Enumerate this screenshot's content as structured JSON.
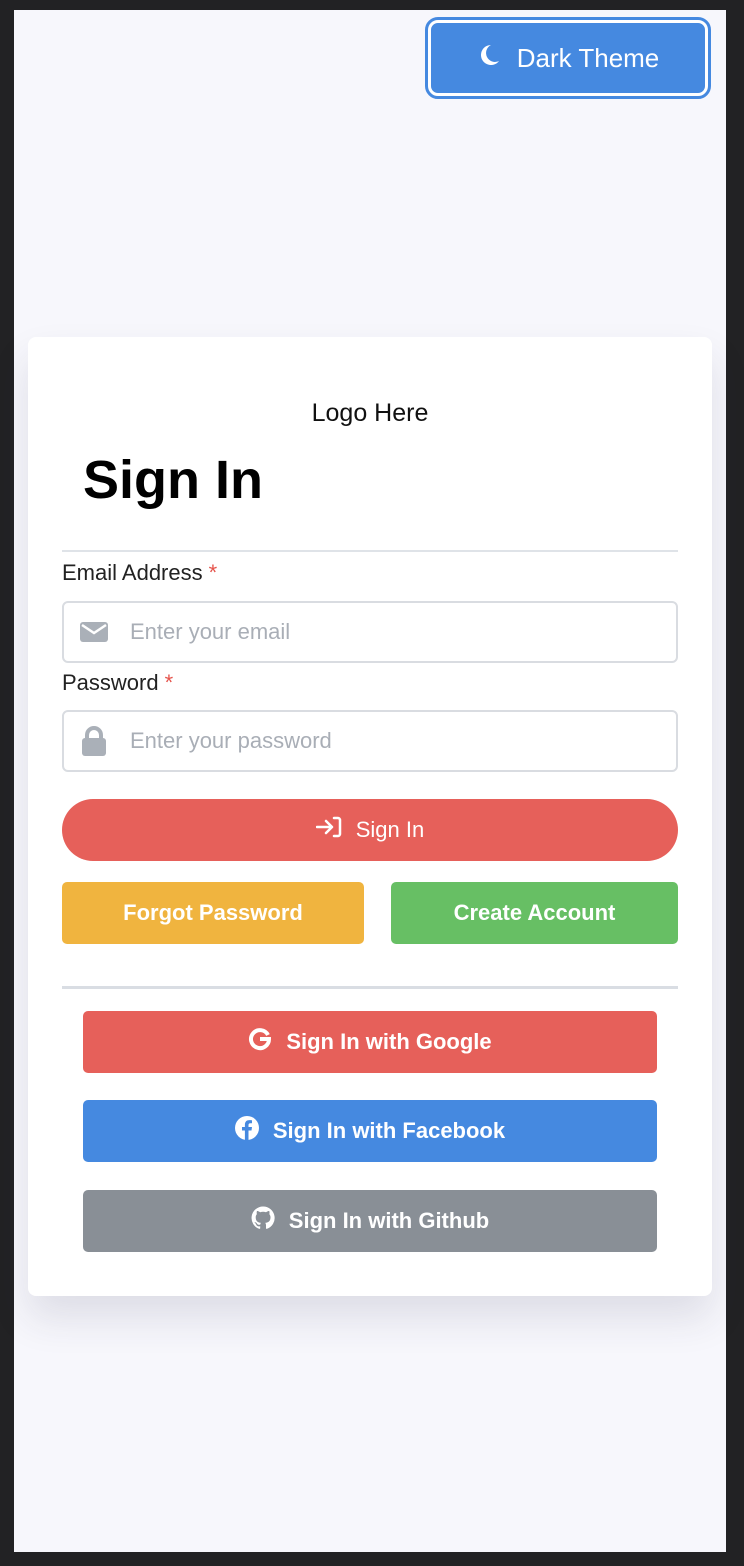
{
  "theme_toggle": {
    "label": "Dark Theme",
    "icon": "moon-icon",
    "color": "#4589e0"
  },
  "card": {
    "logo_text": "Logo Here",
    "title": "Sign In",
    "email": {
      "label": "Email Address",
      "required_mark": "*",
      "placeholder": "Enter your email",
      "value": "",
      "icon": "envelope-icon"
    },
    "password": {
      "label": "Password",
      "required_mark": "*",
      "placeholder": "Enter your password",
      "value": "",
      "icon": "lock-icon"
    },
    "sign_in_button": {
      "label": "Sign In",
      "icon": "sign-in-icon",
      "color": "#e6605a"
    },
    "forgot_password_button": {
      "label": "Forgot Password",
      "color": "#f0b43f"
    },
    "create_account_button": {
      "label": "Create Account",
      "color": "#67bf64"
    },
    "social": [
      {
        "label": "Sign In with Google",
        "icon": "google-icon",
        "color": "#e6605a"
      },
      {
        "label": "Sign In with Facebook",
        "icon": "facebook-icon",
        "color": "#4589e0"
      },
      {
        "label": "Sign In with Github",
        "icon": "github-icon",
        "color": "#898f96"
      }
    ]
  }
}
